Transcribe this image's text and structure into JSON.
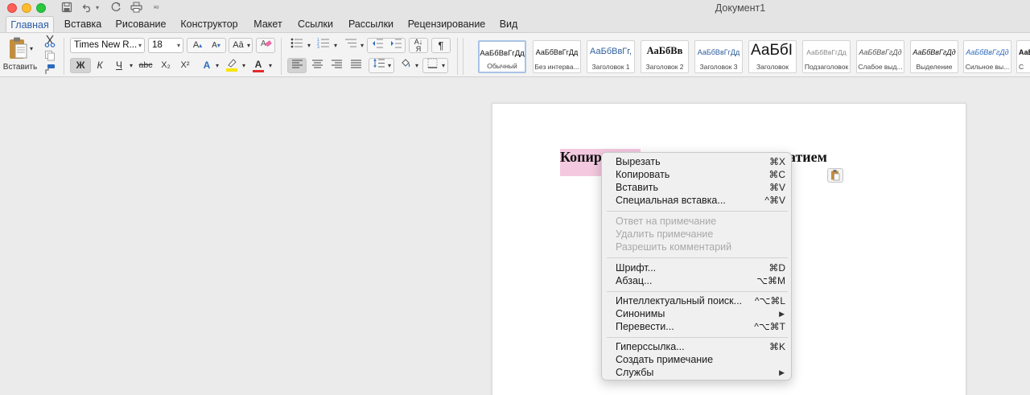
{
  "window": {
    "title": "Документ1"
  },
  "ribbon_tabs": [
    {
      "label": "Главная",
      "active": true
    },
    {
      "label": "Вставка"
    },
    {
      "label": "Рисование"
    },
    {
      "label": "Конструктор"
    },
    {
      "label": "Макет"
    },
    {
      "label": "Ссылки"
    },
    {
      "label": "Рассылки"
    },
    {
      "label": "Рецензирование"
    },
    {
      "label": "Вид"
    }
  ],
  "clipboard": {
    "paste_label": "Вставить"
  },
  "font": {
    "name": "Times New R...",
    "size": "18",
    "bold_label": "Ж",
    "italic_label": "К",
    "underline_label": "Ч",
    "strike_label": "abc",
    "subscript_label": "X₂",
    "superscript_label": "X²",
    "font_color_label": "A",
    "font_color": "#e32b2b",
    "highlight_color": "#f7e500"
  },
  "paragraph": {
    "pilcrow": "¶"
  },
  "styles": [
    {
      "preview": "АаБбВвГгДд",
      "name": "Обычный",
      "selected": true
    },
    {
      "preview": "АаБбВвГгДд",
      "name": "Без интерва..."
    },
    {
      "preview": "АаБбВвГг,",
      "name": "Заголовок 1"
    },
    {
      "preview": "АаБбВв",
      "name": "Заголовок 2"
    },
    {
      "preview": "АаБбВвГгДд",
      "name": "Заголовок 3"
    },
    {
      "preview": "АаБбІ",
      "name": "Заголовок"
    },
    {
      "preview": "АаБбВвГгДд",
      "name": "Подзаголовок"
    },
    {
      "preview": "АаБбВвГгДд",
      "name": "Слабое выд..."
    },
    {
      "preview": "АаБбВвГгДд",
      "name": "Выделение"
    },
    {
      "preview": "АаБбВвГгДд",
      "name": "Сильное вы..."
    },
    {
      "preview": "АаБ",
      "name": "С"
    }
  ],
  "document": {
    "text_visible_left": "Копир",
    "text_visible_right": "атием"
  },
  "context_menu": {
    "groups": [
      [
        {
          "label": "Вырезать",
          "shortcut": "⌘X"
        },
        {
          "label": "Копировать",
          "shortcut": "⌘C"
        },
        {
          "label": "Вставить",
          "shortcut": "⌘V"
        },
        {
          "label": "Специальная вставка...",
          "shortcut": "^⌘V"
        }
      ],
      [
        {
          "label": "Ответ на примечание",
          "disabled": true
        },
        {
          "label": "Удалить примечание",
          "disabled": true
        },
        {
          "label": "Разрешить комментарий",
          "disabled": true
        }
      ],
      [
        {
          "label": "Шрифт...",
          "shortcut": "⌘D"
        },
        {
          "label": "Абзац...",
          "shortcut": "⌥⌘M"
        }
      ],
      [
        {
          "label": "Интеллектуальный поиск...",
          "shortcut": "^⌥⌘L"
        },
        {
          "label": "Синонимы",
          "submenu": true
        },
        {
          "label": "Перевести...",
          "shortcut": "^⌥⌘T"
        }
      ],
      [
        {
          "label": "Гиперссылка...",
          "shortcut": "⌘K"
        },
        {
          "label": "Создать примечание"
        },
        {
          "label": "Службы",
          "submenu": true
        }
      ]
    ]
  }
}
